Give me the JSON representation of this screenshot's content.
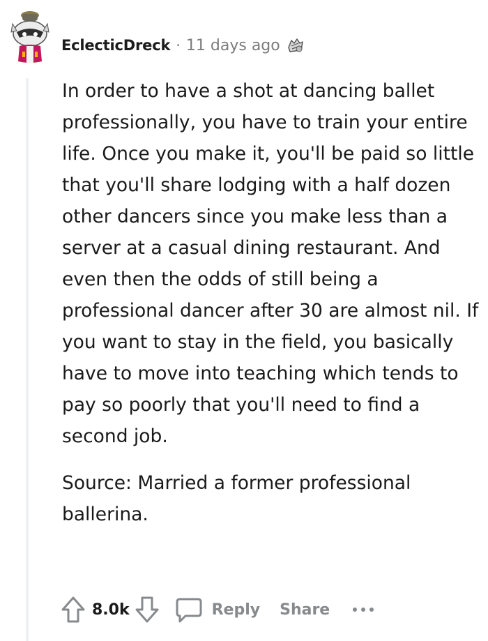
{
  "comment": {
    "author": "EclecticDreck",
    "separator": "·",
    "timestamp": "11 days ago",
    "paragraphs": [
      "In order to have a shot at dancing ballet professionally, you have to train your entire life. Once you make it, you'll be paid so little that you'll share lodging with a half dozen other dancers since you make less than a server at a casual dining restaurant. And even then the odds of still being a professional dancer after 30 are almost nil. If you want to stay in the field, you basically have to move into teaching which tends to pay so poorly that you'll need to find a second job.",
      "Source: Married a former professional ballerina."
    ],
    "score": "8.0k",
    "actions": {
      "reply_label": "Reply",
      "share_label": "Share"
    }
  },
  "icons": {
    "avatar": "snoo-avatar-icon",
    "award": "award-icon",
    "upvote": "upvote-arrow-icon",
    "downvote": "downvote-arrow-icon",
    "reply": "speech-bubble-icon",
    "more": "more-dots-icon"
  },
  "colors": {
    "text": "#1a1a1b",
    "meta": "#7c7c7c",
    "action": "#878a8c",
    "thread_line": "#edeff1"
  }
}
